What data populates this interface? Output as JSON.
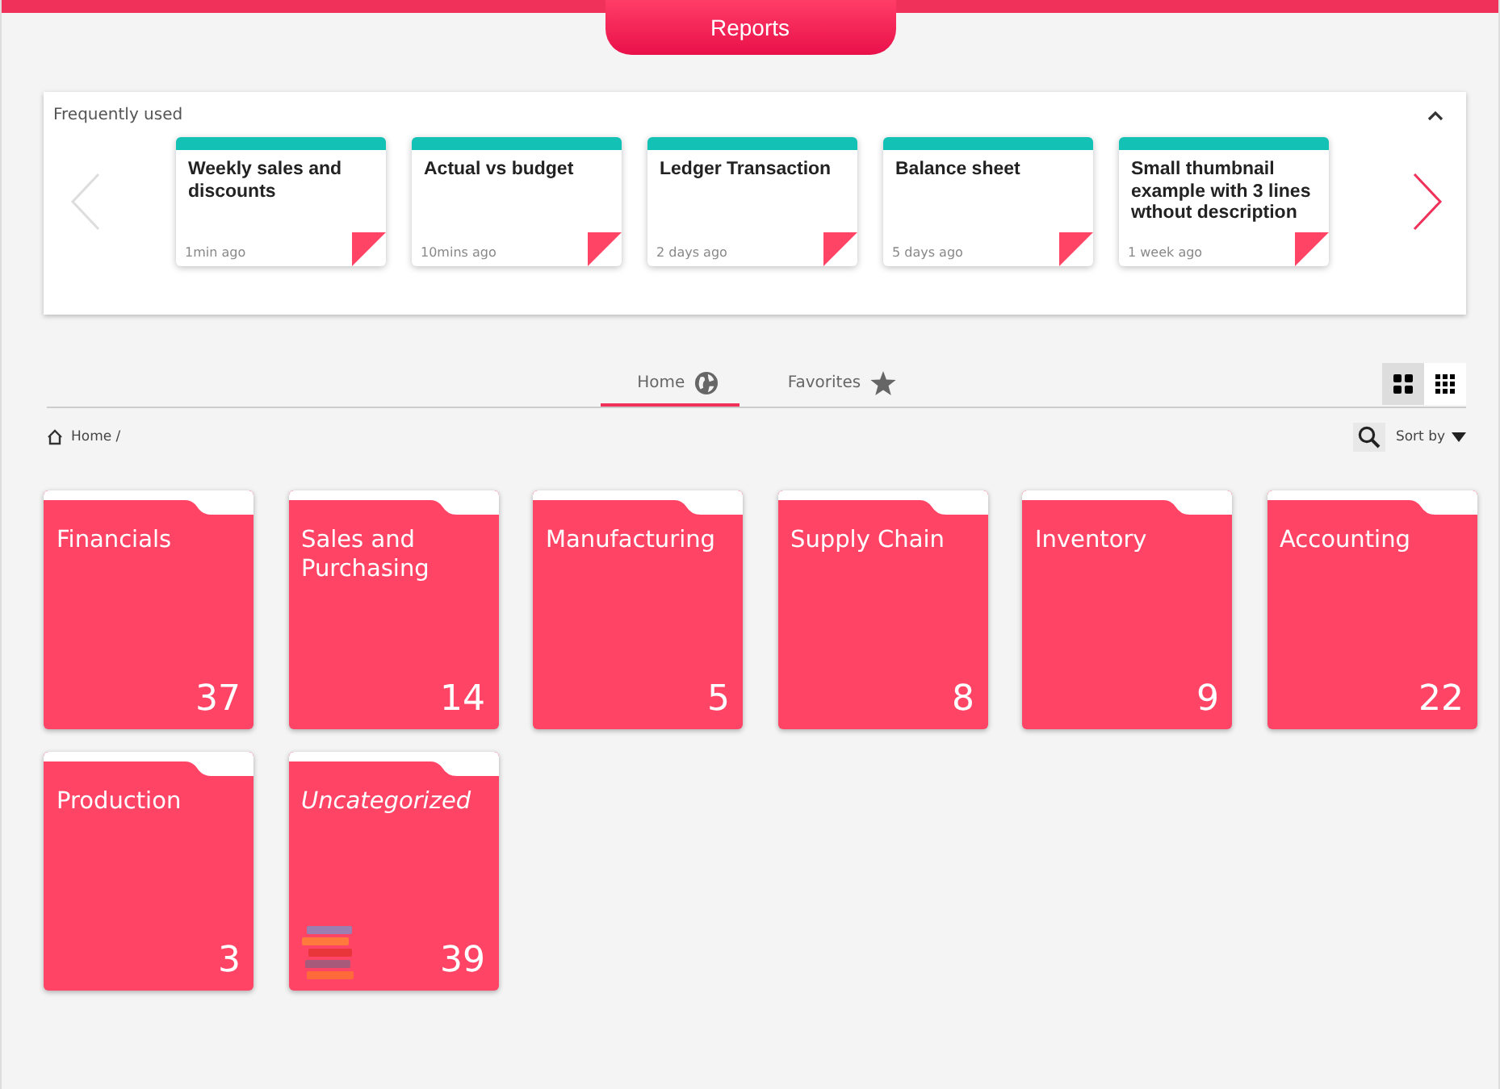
{
  "header": {
    "title": "Reports"
  },
  "frequently_used": {
    "title": "Frequently used",
    "expanded": true,
    "items": [
      {
        "title": "Weekly sales and discounts",
        "time": "1min ago"
      },
      {
        "title": "Actual vs budget",
        "time": "10mins ago"
      },
      {
        "title": "Ledger Transaction",
        "time": "2 days ago"
      },
      {
        "title": "Balance sheet",
        "time": "5 days ago"
      },
      {
        "title": "Small thumbnail example with 3 lines wthout description",
        "time": "1 week ago"
      }
    ]
  },
  "tabs": [
    {
      "label": "Home",
      "kind": "globe",
      "selected": true
    },
    {
      "label": "Favorites",
      "kind": "star",
      "selected": false
    }
  ],
  "view_toggle": [
    {
      "kind": "large",
      "selected": true
    },
    {
      "kind": "small",
      "selected": false
    }
  ],
  "breadcrumb": "Home /",
  "sort": {
    "label": "Sort by"
  },
  "folders": [
    {
      "kind": "category",
      "name": "Financials",
      "count": "37"
    },
    {
      "kind": "category",
      "name": "Sales and Purchasing",
      "count": "14"
    },
    {
      "kind": "category",
      "name": "Manufacturing",
      "count": "5"
    },
    {
      "kind": "category",
      "name": "Supply Chain",
      "count": "8"
    },
    {
      "kind": "category",
      "name": "Inventory",
      "count": "9"
    },
    {
      "kind": "category",
      "name": "Accounting",
      "count": "22"
    },
    {
      "kind": "category",
      "name": "Production",
      "count": "3"
    },
    {
      "kind": "uncategorized",
      "name": "Uncategorized",
      "count": "39"
    }
  ]
}
